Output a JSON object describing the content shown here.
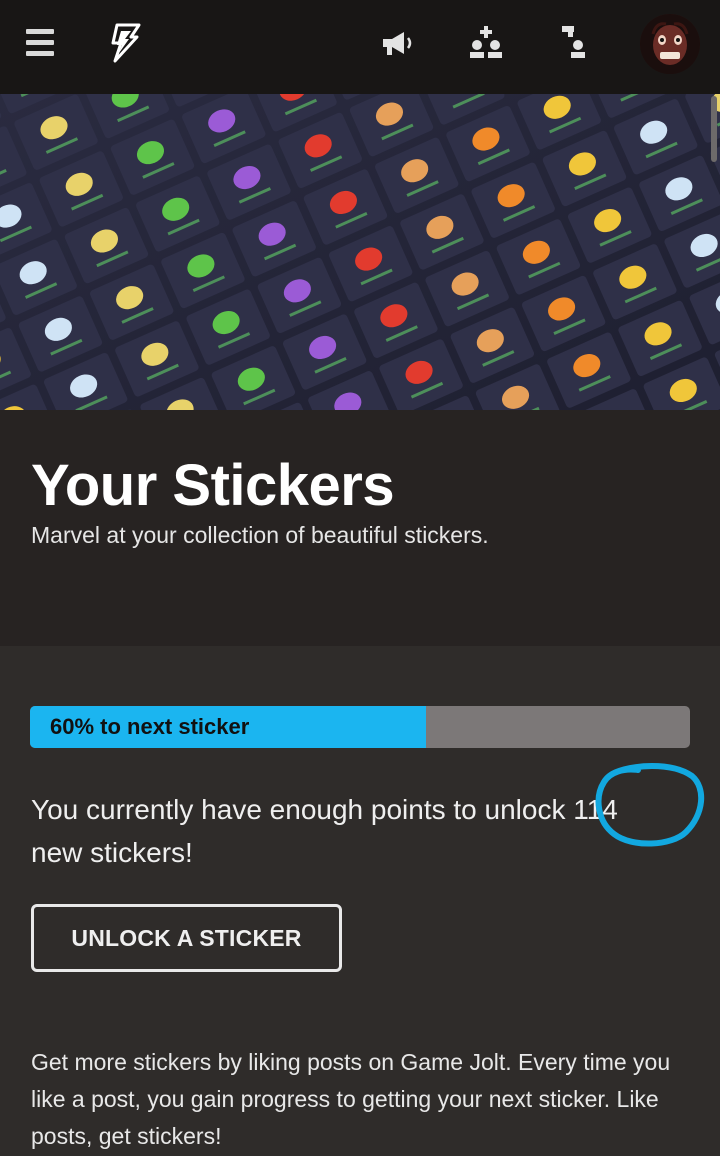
{
  "topbar": {
    "menu_icon": "hamburger-menu-icon",
    "logo_icon": "game-jolt-logo-icon",
    "announcements_icon": "megaphone-icon",
    "friends_icon": "friend-requests-icon",
    "activity_icon": "activity-icon",
    "avatar": "user-avatar"
  },
  "banner": {
    "image": "sticker-collection-banner"
  },
  "header": {
    "title": "Your Stickers",
    "subtitle": "Marvel at your collection of beautiful stickers."
  },
  "progress": {
    "label": "60% to next sticker",
    "percent": 60,
    "fill_color": "#1bb5f0"
  },
  "points": {
    "text": "You currently have enough points to unlock 114 new stickers!",
    "count": "114",
    "annotation_color": "#12a8e0"
  },
  "unlock_button": {
    "label": "UNLOCK A STICKER"
  },
  "footer": {
    "text": "Get more stickers by liking posts on Game Jolt. Every time you like a post, you gain progress to getting your next sticker. Like posts, get stickers!"
  }
}
